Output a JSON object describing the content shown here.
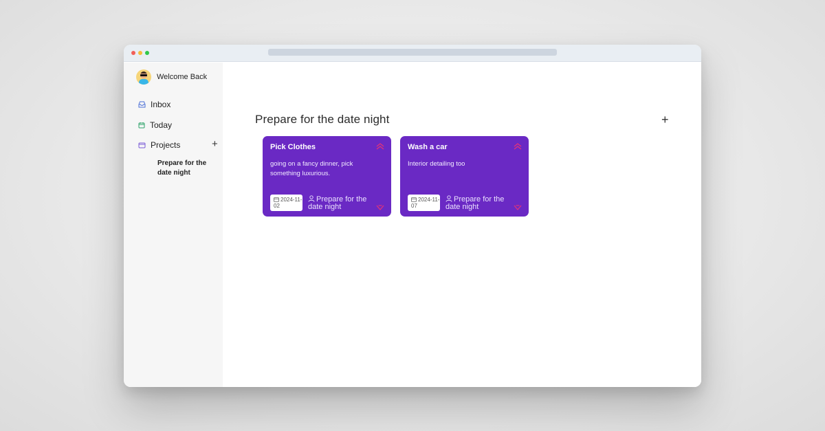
{
  "sidebar": {
    "welcome": "Welcome Back",
    "items": [
      {
        "label": "Inbox",
        "icon": "inbox-icon"
      },
      {
        "label": "Today",
        "icon": "calendar-icon"
      },
      {
        "label": "Projects",
        "icon": "folder-icon"
      }
    ],
    "add_project": "+",
    "projects": [
      "Prepare for the date night"
    ]
  },
  "main": {
    "title": "Prepare for the date night",
    "add_task": "+",
    "cards": [
      {
        "title": "Pick Clothes",
        "description": "going on a fancy dinner, pick something luxurious.",
        "date": "2024-11-02",
        "project": "Prepare for the date night"
      },
      {
        "title": "Wash a car",
        "description": "Interior detailing too",
        "date": "2024-11-07",
        "project": "Prepare for the date night"
      }
    ]
  },
  "colors": {
    "card": "#6a29c4",
    "priority_icon": "#e0337a",
    "sidebar_bg": "#f6f6f6",
    "dot_red": "#f25f58",
    "dot_yellow": "#f6bd3a",
    "dot_green": "#2fc84a"
  }
}
